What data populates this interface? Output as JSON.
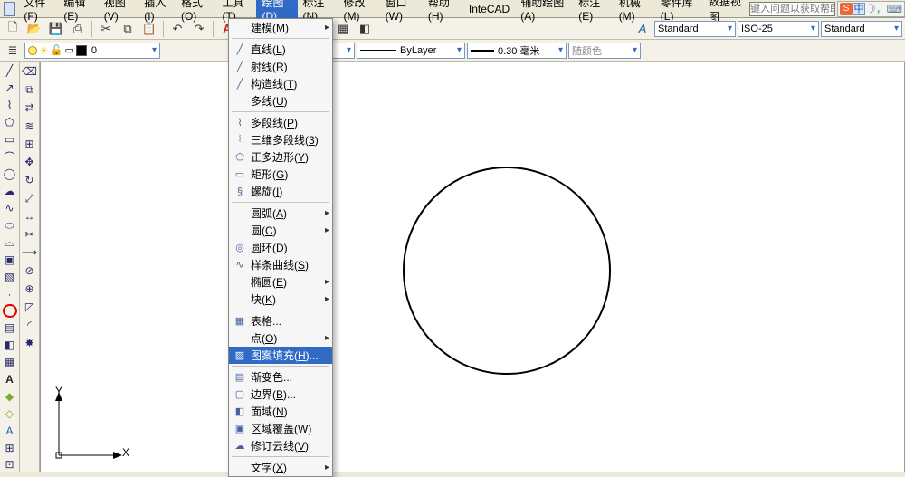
{
  "menubar": {
    "items": [
      "文件(F)",
      "编辑(E)",
      "视图(V)",
      "插入(I)",
      "格式(O)",
      "工具(T)",
      "绘图(D)",
      "标注(N)",
      "修改(M)",
      "窗口(W)",
      "帮助(H)",
      "InteCAD",
      "辅助绘图(A)",
      "标注(E)",
      "机械(M)",
      "零件库(L)",
      "数据视图"
    ],
    "active_index": 6,
    "help_placeholder": "键入问题以获取帮助",
    "ime_char": "中"
  },
  "toolbar2": {
    "bylayer": "ByLayer",
    "lineweight": "0.30 毫米",
    "randcolor": "随颜色",
    "textstyle": "Standard",
    "dimstyle": "ISO-25",
    "tablestyle": "Standard",
    "layer_name": "0"
  },
  "dropdown": {
    "items": [
      {
        "label": "建模",
        "hotkey": "M",
        "submenu": true
      },
      {
        "sep": true
      },
      {
        "label": "直线",
        "hotkey": "L",
        "icon": "╱"
      },
      {
        "label": "射线",
        "hotkey": "R",
        "icon": "╱"
      },
      {
        "label": "构造线",
        "hotkey": "T",
        "icon": "╱"
      },
      {
        "label": "多线",
        "hotkey": "U"
      },
      {
        "sep": true
      },
      {
        "label": "多段线",
        "hotkey": "P",
        "icon": "⌇"
      },
      {
        "label": "三维多段线",
        "hotkey": "3",
        "icon": "⦚"
      },
      {
        "label": "正多边形",
        "hotkey": "Y",
        "icon": "⬠"
      },
      {
        "label": "矩形",
        "hotkey": "G",
        "icon": "▭"
      },
      {
        "label": "螺旋",
        "hotkey": "I",
        "icon": "§"
      },
      {
        "sep": true
      },
      {
        "label": "圆弧",
        "hotkey": "A",
        "submenu": true
      },
      {
        "label": "圆",
        "hotkey": "C",
        "submenu": true
      },
      {
        "label": "圆环",
        "hotkey": "D",
        "icon": "◎"
      },
      {
        "label": "样条曲线",
        "hotkey": "S",
        "icon": "∿"
      },
      {
        "label": "椭圆",
        "hotkey": "E",
        "submenu": true
      },
      {
        "label": "块",
        "hotkey": "K",
        "submenu": true
      },
      {
        "sep": true
      },
      {
        "label": "表格...",
        "hotkey": "",
        "icon": "▦"
      },
      {
        "label": "点",
        "hotkey": "O",
        "submenu": true
      },
      {
        "label": "图案填充",
        "hotkey": "H",
        "icon": "▨",
        "sel": true,
        "suffix": "..."
      },
      {
        "sep": true
      },
      {
        "label": "渐变色...",
        "hotkey": "",
        "icon": "▤"
      },
      {
        "label": "边界",
        "hotkey": "B",
        "icon": "▢",
        "suffix": "..."
      },
      {
        "label": "面域",
        "hotkey": "N",
        "icon": "◧"
      },
      {
        "label": "区域覆盖",
        "hotkey": "W",
        "icon": "▣"
      },
      {
        "label": "修订云线",
        "hotkey": "V",
        "icon": "☁"
      },
      {
        "sep": true
      },
      {
        "label": "文字",
        "hotkey": "X",
        "submenu": true
      }
    ]
  },
  "axis": {
    "x": "X",
    "y": "Y"
  },
  "chart_data": {
    "type": "line",
    "title": "",
    "xlabel": "",
    "ylabel": "",
    "series": [
      {
        "name": "circle",
        "values": []
      }
    ]
  }
}
